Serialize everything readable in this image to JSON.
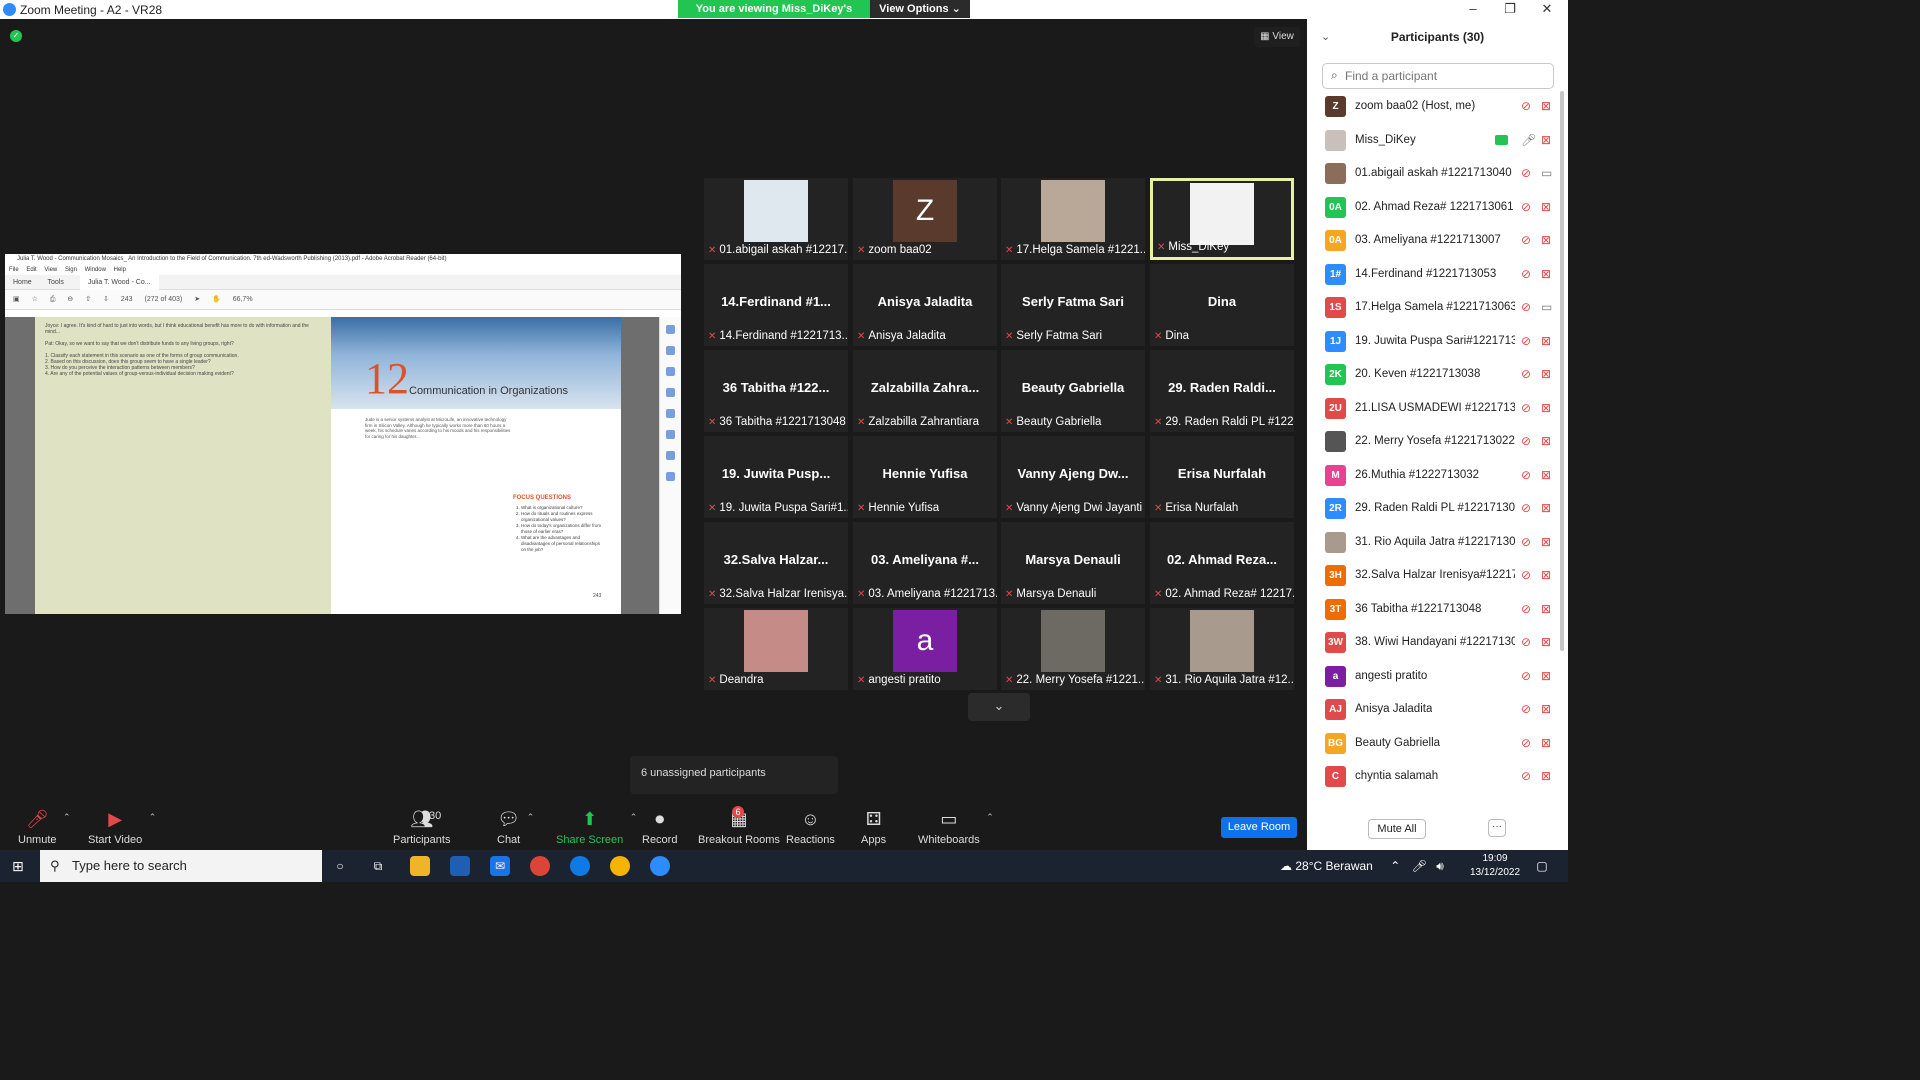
{
  "window": {
    "title": "Zoom Meeting - A2 - VR28",
    "min": "–",
    "max": "❐",
    "close": "✕"
  },
  "banner": {
    "viewing": "You are viewing Miss_DiKey's screen",
    "view_options": "View Options ⌄"
  },
  "view_button": "View",
  "acrobat": {
    "title": "Julia T. Wood - Communication Mosaics_ An Introduction to the Field of Communication. 7th ed-Wadsworth Publishing (2013).pdf - Adobe Acrobat Reader (64-bit)",
    "menu": [
      "File",
      "Edit",
      "View",
      "Sign",
      "Window",
      "Help"
    ],
    "tabs": [
      "Home",
      "Tools",
      "Julia T. Wood - Co..."
    ],
    "page_input": "243",
    "page_total": "(272 of 403)",
    "zoom": "66,7%",
    "chapter_number": "12",
    "chapter_title": "Communication in Organizations",
    "focus_title": "FOCUS QUESTIONS",
    "focus_questions": [
      "What is organizational culture?",
      "How do rituals and routines express organizational values?",
      "How do today's organizations differ from those of earlier eras?",
      "What are the advantages and disadvantages of personal relationships on the job?"
    ],
    "page_number": "243"
  },
  "tiles": [
    {
      "name": "",
      "label": "01.abigail askah #12217...",
      "kind": "photo",
      "color": "#dfe8ee"
    },
    {
      "name": "",
      "label": "zoom baa02",
      "kind": "letter",
      "letter": "Z",
      "color": "#5b3a2e"
    },
    {
      "name": "",
      "label": "17.Helga Samela #1221...",
      "kind": "photo",
      "color": "#b9a797"
    },
    {
      "name": "",
      "label": "Miss_DiKey",
      "kind": "photo",
      "color": "#f2f2f2",
      "active": true
    },
    {
      "name": "14.Ferdinand #1...",
      "label": "14.Ferdinand #1221713..."
    },
    {
      "name": "Anisya Jaladita",
      "label": "Anisya Jaladita"
    },
    {
      "name": "Serly Fatma Sari",
      "label": "Serly Fatma Sari"
    },
    {
      "name": "Dina",
      "label": "Dina"
    },
    {
      "name": "36 Tabitha #122...",
      "label": "36 Tabitha #1221713048"
    },
    {
      "name": "Zalzabilla Zahra...",
      "label": "Zalzabilla Zahrantiara"
    },
    {
      "name": "Beauty Gabriella",
      "label": "Beauty Gabriella"
    },
    {
      "name": "29. Raden Raldi...",
      "label": "29. Raden Raldi PL #122..."
    },
    {
      "name": "19. Juwita Pusp...",
      "label": "19. Juwita Puspa Sari#1..."
    },
    {
      "name": "Hennie Yufisa",
      "label": "Hennie Yufisa"
    },
    {
      "name": "Vanny Ajeng Dw...",
      "label": "Vanny Ajeng Dwi Jayanti"
    },
    {
      "name": "Erisa Nurfalah",
      "label": "Erisa Nurfalah"
    },
    {
      "name": "32.Salva Halzar...",
      "label": "32.Salva Halzar Irenisya..."
    },
    {
      "name": "03. Ameliyana #...",
      "label": "03. Ameliyana #1221713..."
    },
    {
      "name": "Marsya Denauli",
      "label": "Marsya Denauli"
    },
    {
      "name": "02. Ahmad Reza...",
      "label": "02. Ahmad Reza# 12217..."
    },
    {
      "name": "",
      "label": "Deandra",
      "kind": "photo",
      "color": "#c58b86"
    },
    {
      "name": "",
      "label": "angesti pratito",
      "kind": "letter",
      "letter": "a",
      "color": "#7a1fa2"
    },
    {
      "name": "",
      "label": "22. Merry Yosefa #1221...",
      "kind": "photo",
      "color": "#6c6a63"
    },
    {
      "name": "",
      "label": "31. Rio Aquila Jatra #12...",
      "kind": "photo",
      "color": "#a89a8c"
    }
  ],
  "unassigned": "6 unassigned participants",
  "toolbar": {
    "unmute": "Unmute",
    "start_video": "Start Video",
    "participants": "Participants",
    "participants_count": "30",
    "chat": "Chat",
    "share_screen": "Share Screen",
    "record": "Record",
    "breakout": "Breakout Rooms",
    "breakout_badge": "6",
    "reactions": "Reactions",
    "apps": "Apps",
    "whiteboards": "Whiteboards",
    "leave": "Leave Room"
  },
  "panel": {
    "title": "Participants (30)",
    "search_placeholder": "Find a participant",
    "mute_all": "Mute All",
    "more": "···",
    "participants": [
      {
        "name": "zoom baa02 (Host, me)",
        "initials": "Z",
        "color": "#5b3a2e"
      },
      {
        "name": "Miss_DiKey",
        "initials": "",
        "color": "#c9c0bb",
        "share": true,
        "mic_on": true
      },
      {
        "name": "01.abigail askah #1221713040",
        "initials": "",
        "color": "#8c6d5b",
        "video_on": true
      },
      {
        "name": "02. Ahmad Reza# 1221713061",
        "initials": "0A",
        "color": "#23c552"
      },
      {
        "name": "03. Ameliyana #1221713007",
        "initials": "0A",
        "color": "#f5a623"
      },
      {
        "name": "14.Ferdinand #1221713053",
        "initials": "1#",
        "color": "#2d8cff"
      },
      {
        "name": "17.Helga Samela #1221713063",
        "initials": "1S",
        "color": "#e04a4a",
        "video_on": true
      },
      {
        "name": "19. Juwita Puspa Sari#1221713...",
        "initials": "1J",
        "color": "#2d8cff"
      },
      {
        "name": "20. Keven #1221713038",
        "initials": "2K",
        "color": "#23c552"
      },
      {
        "name": "21.LISA USMADEWI #12217130...",
        "initials": "2U",
        "color": "#e04a4a"
      },
      {
        "name": "22. Merry Yosefa #1221713022",
        "initials": "",
        "color": "#555"
      },
      {
        "name": "26.Muthia #1222713032",
        "initials": "M",
        "color": "#e84393"
      },
      {
        "name": "29. Raden Raldi PL #1221713030",
        "initials": "2R",
        "color": "#2d8cff"
      },
      {
        "name": "31. Rio Aquila Jatra #12217130...",
        "initials": "",
        "color": "#a89a8c"
      },
      {
        "name": "32.Salva Halzar Irenisya#12217...",
        "initials": "3H",
        "color": "#ef6c00"
      },
      {
        "name": "36 Tabitha #1221713048",
        "initials": "3T",
        "color": "#ef6c00"
      },
      {
        "name": "38. Wiwi Handayani #12217130...",
        "initials": "3W",
        "color": "#e04a4a"
      },
      {
        "name": "angesti pratito",
        "initials": "a",
        "color": "#7a1fa2"
      },
      {
        "name": "Anisya Jaladita",
        "initials": "AJ",
        "color": "#e04a4a"
      },
      {
        "name": "Beauty Gabriella",
        "initials": "BG",
        "color": "#f5a623"
      },
      {
        "name": "chyntia salamah",
        "initials": "C",
        "color": "#e04a4a"
      }
    ]
  },
  "taskbar": {
    "search_placeholder": "Type here to search",
    "weather": "28°C Berawan",
    "time": "19:09",
    "date": "13/12/2022"
  }
}
